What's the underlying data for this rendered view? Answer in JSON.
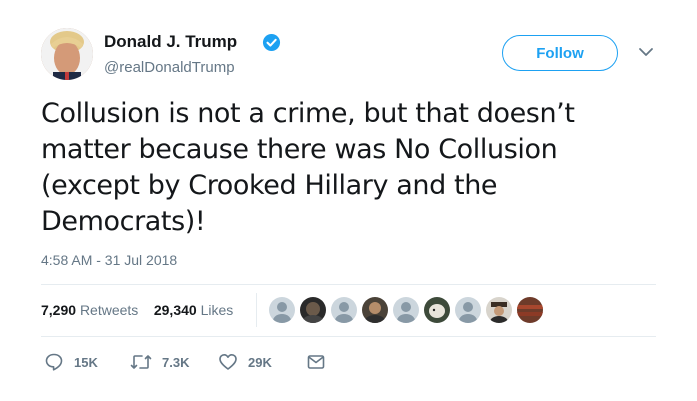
{
  "author": {
    "name": "Donald J. Trump",
    "handle": "@realDonaldTrump",
    "verified": true
  },
  "follow_label": "Follow",
  "tweet": {
    "lines": [
      "Collusion is not a crime, but that doesn’t",
      "matter because there was No Collusion",
      "(except by Crooked Hillary and the",
      "Democrats)!"
    ],
    "timestamp": "4:58 AM - 31 Jul 2018"
  },
  "stats": {
    "retweets_count": "7,290",
    "retweets_label": "Retweets",
    "likes_count": "29,340",
    "likes_label": "Likes"
  },
  "liked_by_avatars": [
    "default-avatar-icon",
    "user-avatar",
    "default-avatar-icon",
    "user-avatar",
    "default-avatar-icon",
    "user-avatar",
    "default-avatar-icon",
    "user-avatar",
    "user-avatar"
  ],
  "actions": {
    "reply_count": "15K",
    "retweet_count": "7.3K",
    "like_count": "29K"
  },
  "colors": {
    "accent": "#1da1f2",
    "secondary_text": "#657786",
    "primary_text": "#14171a",
    "divider": "#e6ecf0"
  }
}
